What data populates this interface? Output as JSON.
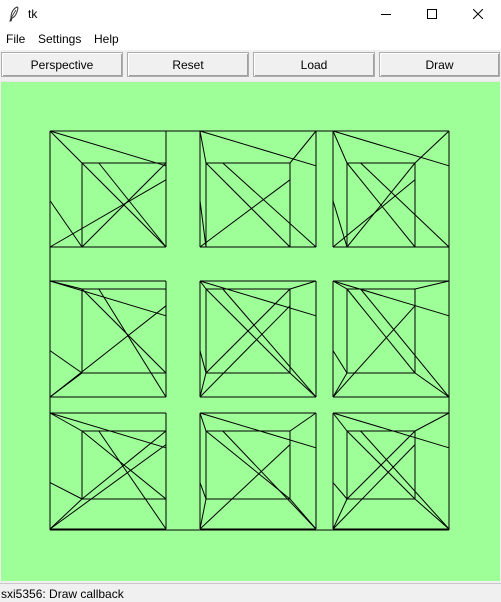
{
  "window": {
    "title": "tk",
    "icon": "feather-icon",
    "controls": [
      "minimize-icon",
      "maximize-icon",
      "close-icon"
    ]
  },
  "menu": {
    "items": [
      {
        "label": "File"
      },
      {
        "label": "Settings"
      },
      {
        "label": "Help"
      }
    ]
  },
  "toolbar": {
    "buttons": [
      {
        "label": "Perspective"
      },
      {
        "label": "Reset"
      },
      {
        "label": "Load"
      },
      {
        "label": "Draw"
      }
    ]
  },
  "canvas": {
    "background": "#9efe98",
    "stroke": "#000000",
    "content": "3x3 grid of wireframe cubes with triangulated faces"
  },
  "status": {
    "text": "sxi5356: Draw callback"
  }
}
